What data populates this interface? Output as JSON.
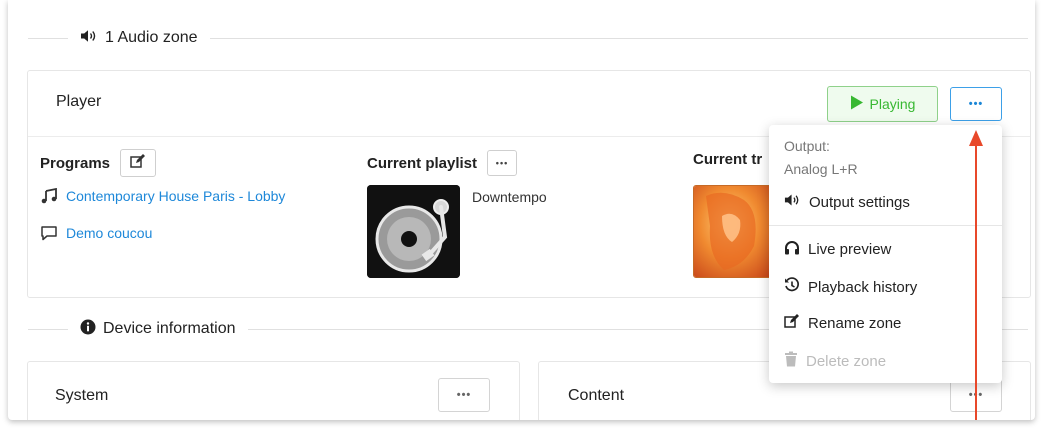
{
  "audio_zone": {
    "title": "1 Audio zone"
  },
  "player": {
    "title": "Player",
    "playing_label": "Playing",
    "more_label": "•••",
    "programs": {
      "label": "Programs",
      "items": [
        {
          "label": "Contemporary House Paris - Lobby",
          "icon": "music-note-icon"
        },
        {
          "label": "Demo coucou",
          "icon": "speech-bubble-icon"
        }
      ]
    },
    "current_playlist": {
      "label": "Current playlist",
      "name": "Downtempo"
    },
    "current_track": {
      "label": "Current tr"
    }
  },
  "menu": {
    "output_label": "Output:",
    "output_value": "Analog L+R",
    "items": [
      {
        "label": "Output settings",
        "icon": "speaker-icon",
        "disabled": false
      },
      {
        "label": "Live preview",
        "icon": "headphones-icon",
        "disabled": false
      },
      {
        "label": "Playback history",
        "icon": "history-icon",
        "disabled": false
      },
      {
        "label": "Rename zone",
        "icon": "edit-icon",
        "disabled": false
      },
      {
        "label": "Delete zone",
        "icon": "trash-icon",
        "disabled": true
      }
    ]
  },
  "device_info": {
    "title": "Device information",
    "system": {
      "title": "System"
    },
    "content": {
      "title": "Content"
    }
  },
  "colors": {
    "link": "#1e88d9",
    "playing_green": "#38b832",
    "accent_blue": "#3da0e8",
    "annotation_arrow": "#e8482a"
  }
}
